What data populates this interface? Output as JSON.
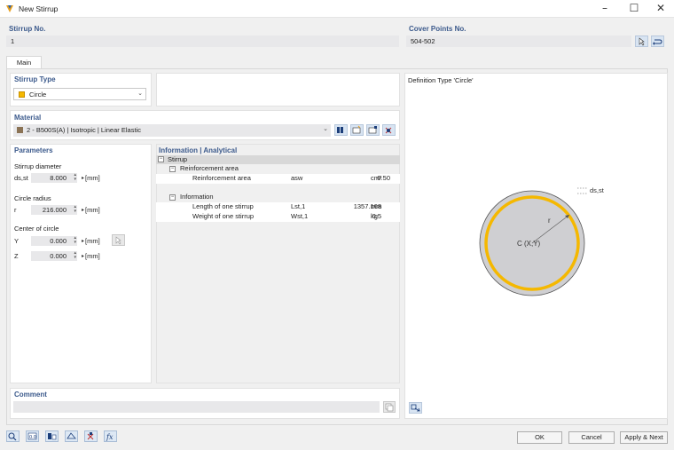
{
  "window": {
    "title": "New Stirrup"
  },
  "stirrup_no": {
    "label": "Stirrup No.",
    "value": "1"
  },
  "cover_points": {
    "label": "Cover Points No.",
    "value": "504-502"
  },
  "tabs": [
    {
      "label": "Main"
    }
  ],
  "stirrup_type": {
    "label": "Stirrup Type",
    "value": "Circle",
    "color": "#f5b800"
  },
  "material": {
    "label": "Material",
    "value": "2 - B500S(A) | Isotropic | Linear Elastic",
    "color": "#8b7355"
  },
  "parameters": {
    "title": "Parameters",
    "diameter_label": "Stirrup diameter",
    "diameter_symbol": "ds,st",
    "diameter_value": "8.000",
    "diameter_unit": "[mm]",
    "radius_label": "Circle radius",
    "radius_symbol": "r",
    "radius_value": "216.000",
    "radius_unit": "[mm]",
    "center_label": "Center of circle",
    "y_symbol": "Y",
    "y_value": "0.000",
    "y_unit": "[mm]",
    "z_symbol": "Z",
    "z_value": "0.000",
    "z_unit": "[mm]"
  },
  "information": {
    "title": "Information | Analytical",
    "root": "Stirrup",
    "group1": "Reinforcement area",
    "row1": {
      "label": "Reinforcement area",
      "symbol": "asw",
      "value": "0.50",
      "unit": "cm²"
    },
    "group2": "Information",
    "row2": {
      "label": "Length of one stirrup",
      "symbol": "Lst,1",
      "value": "1357.168",
      "unit": "mm"
    },
    "row3": {
      "label": "Weight of one stirrup",
      "symbol": "Wst,1",
      "value": "0.5",
      "unit": "kg"
    }
  },
  "definition": {
    "title": "Definition Type 'Circle'",
    "center_label": "C (X,Y)",
    "radius_label": "r",
    "diameter_label": "ds,st"
  },
  "comment": {
    "label": "Comment",
    "value": ""
  },
  "footer": {
    "ok": "OK",
    "cancel": "Cancel",
    "apply_next": "Apply & Next"
  }
}
